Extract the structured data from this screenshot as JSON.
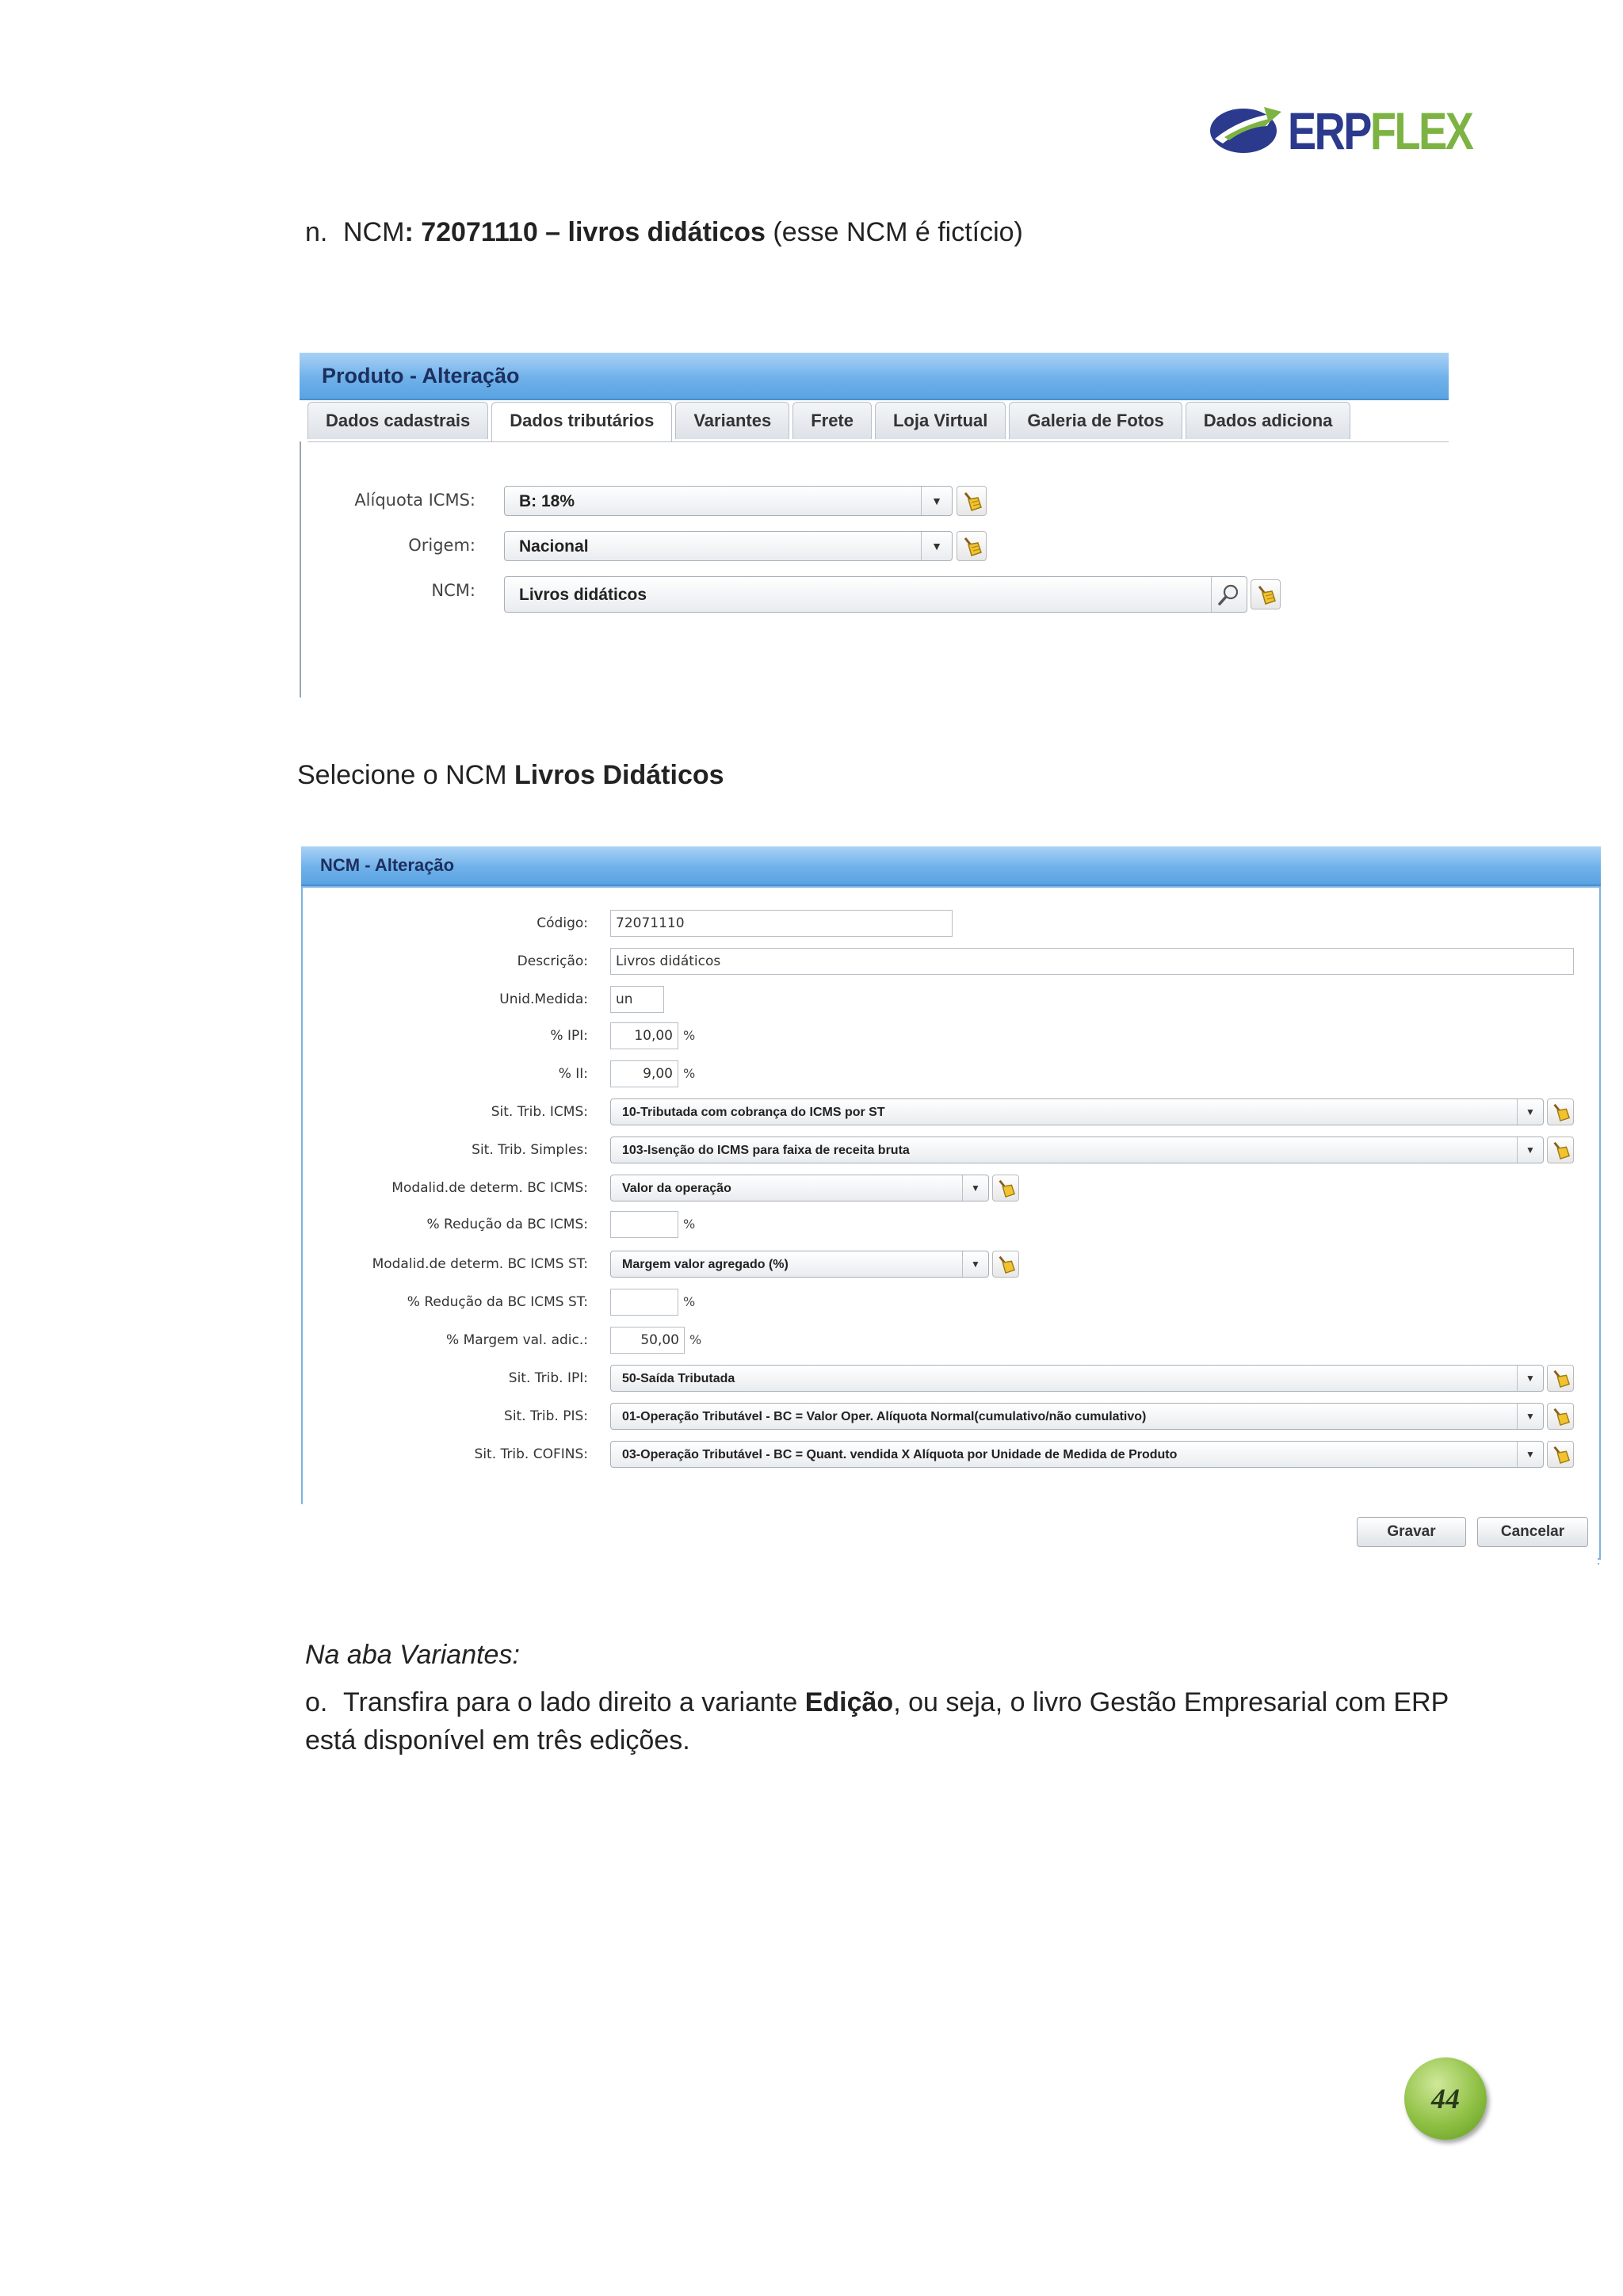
{
  "logo": {
    "text_part1": "ERP",
    "text_part2": "FLEX"
  },
  "item_n": {
    "marker": "n.",
    "prefix": "NCM",
    "bold": ": 72071110 – livros didáticos",
    "suffix": " (esse NCM é fictício)"
  },
  "produto_window": {
    "title": "Produto - Alteração",
    "tabs": [
      "Dados cadastrais",
      "Dados tributários",
      "Variantes",
      "Frete",
      "Loja Virtual",
      "Galeria de Fotos",
      "Dados adiciona"
    ],
    "active_tab": "Dados tributários",
    "fields": {
      "aliquota_label": "Alíquota ICMS:",
      "aliquota_value": "B: 18%",
      "origem_label": "Origem:",
      "origem_value": "Nacional",
      "ncm_label": "NCM:",
      "ncm_value": "Livros didáticos"
    }
  },
  "select_caption": {
    "prefix": "Selecione o NCM ",
    "bold": "Livros Didáticos"
  },
  "ncm_window": {
    "title": "NCM - Alteração",
    "codigo_label": "Código:",
    "codigo_value": "72071110",
    "descricao_label": "Descrição:",
    "descricao_value": "Livros didáticos",
    "unid_label": "Unid.Medida:",
    "unid_value": "un",
    "ipi_label": "% IPI:",
    "ipi_value": "10,00",
    "ii_label": "% II:",
    "ii_value": "9,00",
    "sit_icms_label": "Sit. Trib. ICMS:",
    "sit_icms_value": "10-Tributada com cobrança do ICMS por ST",
    "sit_simples_label": "Sit. Trib. Simples:",
    "sit_simples_value": "103-Isenção do ICMS para faixa de receita bruta",
    "modalid_bc_label": "Modalid.de determ. BC ICMS:",
    "modalid_bc_value": "Valor da operação",
    "reducao_bc_label": "% Redução da BC ICMS:",
    "reducao_bc_value": "",
    "modalid_bc_st_label": "Modalid.de determ. BC ICMS ST:",
    "modalid_bc_st_value": "Margem valor agregado (%)",
    "reducao_bc_st_label": "% Redução da BC ICMS ST:",
    "reducao_bc_st_value": "",
    "margem_label": "% Margem val. adic.:",
    "margem_value": "50,00",
    "sit_ipi_label": "Sit. Trib. IPI:",
    "sit_ipi_value": "50-Saída Tributada",
    "sit_pis_label": "Sit. Trib. PIS:",
    "sit_pis_value": "01-Operação Tributável - BC = Valor Oper. Alíquota Normal(cumulativo/não cumulativo)",
    "sit_cofins_label": "Sit. Trib. COFINS:",
    "sit_cofins_value": "03-Operação Tributável - BC = Quant. vendida X Alíquota por Unidade de Medida de Produto",
    "percent_unit": "%",
    "gravar": "Gravar",
    "cancelar": "Cancelar"
  },
  "aba_caption": "Na aba Variantes:",
  "item_o": {
    "marker": "o.",
    "prefix": "Transfira para o lado direito a variante ",
    "bold": "Edição",
    "suffix": ", ou seja, o livro Gestão Empresarial com ERP está disponível em três edições."
  },
  "page_number": "44",
  "colors": {
    "brand_blue": "#2b3a8c",
    "brand_green": "#7cb342",
    "title_bar": "#6fb1ea"
  },
  "icons": [
    "erpflex-logo-icon",
    "chevron-down-icon",
    "broom-clear-icon",
    "magnifier-search-icon"
  ]
}
